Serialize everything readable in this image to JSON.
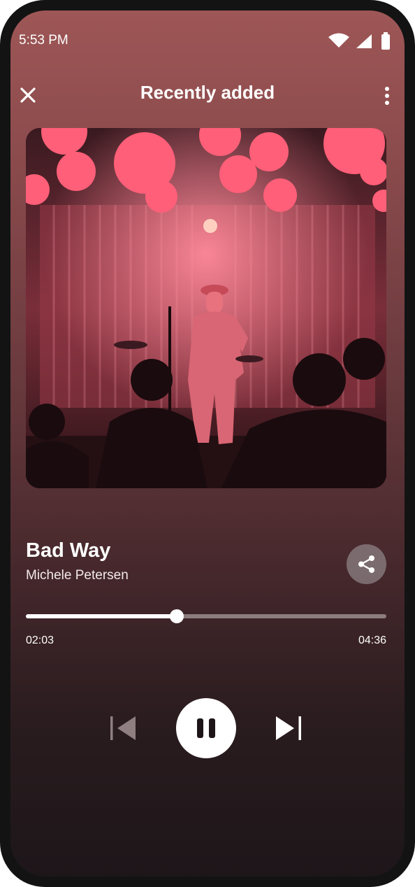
{
  "status_bar": {
    "time": "5:53 PM",
    "icons": [
      "wifi-icon",
      "cellular-signal-icon",
      "battery-icon"
    ]
  },
  "header": {
    "title": "Recently added",
    "close_icon": "close-icon",
    "menu_icon": "more-vertical-icon"
  },
  "artwork": {
    "subject": "Performer in a military-style cap singing on a stage lit with pink/red lights and balloons, audience silhouettes in foreground"
  },
  "track": {
    "title": "Bad Way",
    "artist": "Michele Petersen",
    "share_icon": "share-icon"
  },
  "progress": {
    "elapsed": "02:03",
    "total": "04:36",
    "fraction": 0.418
  },
  "controls": {
    "previous_icon": "skip-previous-icon",
    "pause_icon": "pause-icon",
    "next_icon": "skip-next-icon"
  },
  "colors": {
    "background_top": "#9e5656",
    "background_bottom": "#1d1619",
    "accent": "#ffffff",
    "artwork_tint": "#f0506a"
  }
}
